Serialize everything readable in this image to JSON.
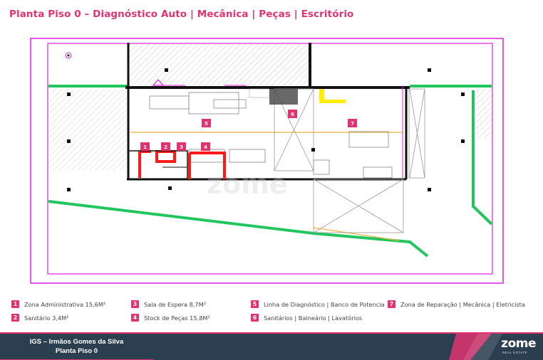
{
  "title": "Planta Piso 0 – Diagnóstico Auto | Mecânica | Peças | Escritório",
  "watermark": "zome",
  "plan_badges": [
    "1",
    "2",
    "3",
    "4",
    "5",
    "6",
    "7"
  ],
  "legend": [
    {
      "num": "1",
      "text": "Zona Administrativa 15,6M²"
    },
    {
      "num": "2",
      "text": "Sanitário 3,4M²"
    },
    {
      "num": "3",
      "text": "Sala de Espera 8,7M²"
    },
    {
      "num": "4",
      "text": "Stock de Peças 15,8M²"
    },
    {
      "num": "5",
      "text": "Linha de Diagnóstico | Banco de Potencia"
    },
    {
      "num": "6",
      "text": "Sanitários | Balneário | Lavatórios"
    },
    {
      "num": "7",
      "text": "Zona de Reparação | Mecânica | Eletricista"
    }
  ],
  "footer": {
    "line1": "IGS – Irmãos Gomes da Silva",
    "line2": "Planta Piso 0",
    "logo": "zome",
    "logo_sub": "REAL ESTATE"
  },
  "colors": {
    "accent": "#e0336f",
    "footer_bg": "#2c3f51",
    "green": "#22c55e",
    "magenta": "#e020e0",
    "red": "#ff1a1a",
    "yellow": "#ffee00"
  }
}
